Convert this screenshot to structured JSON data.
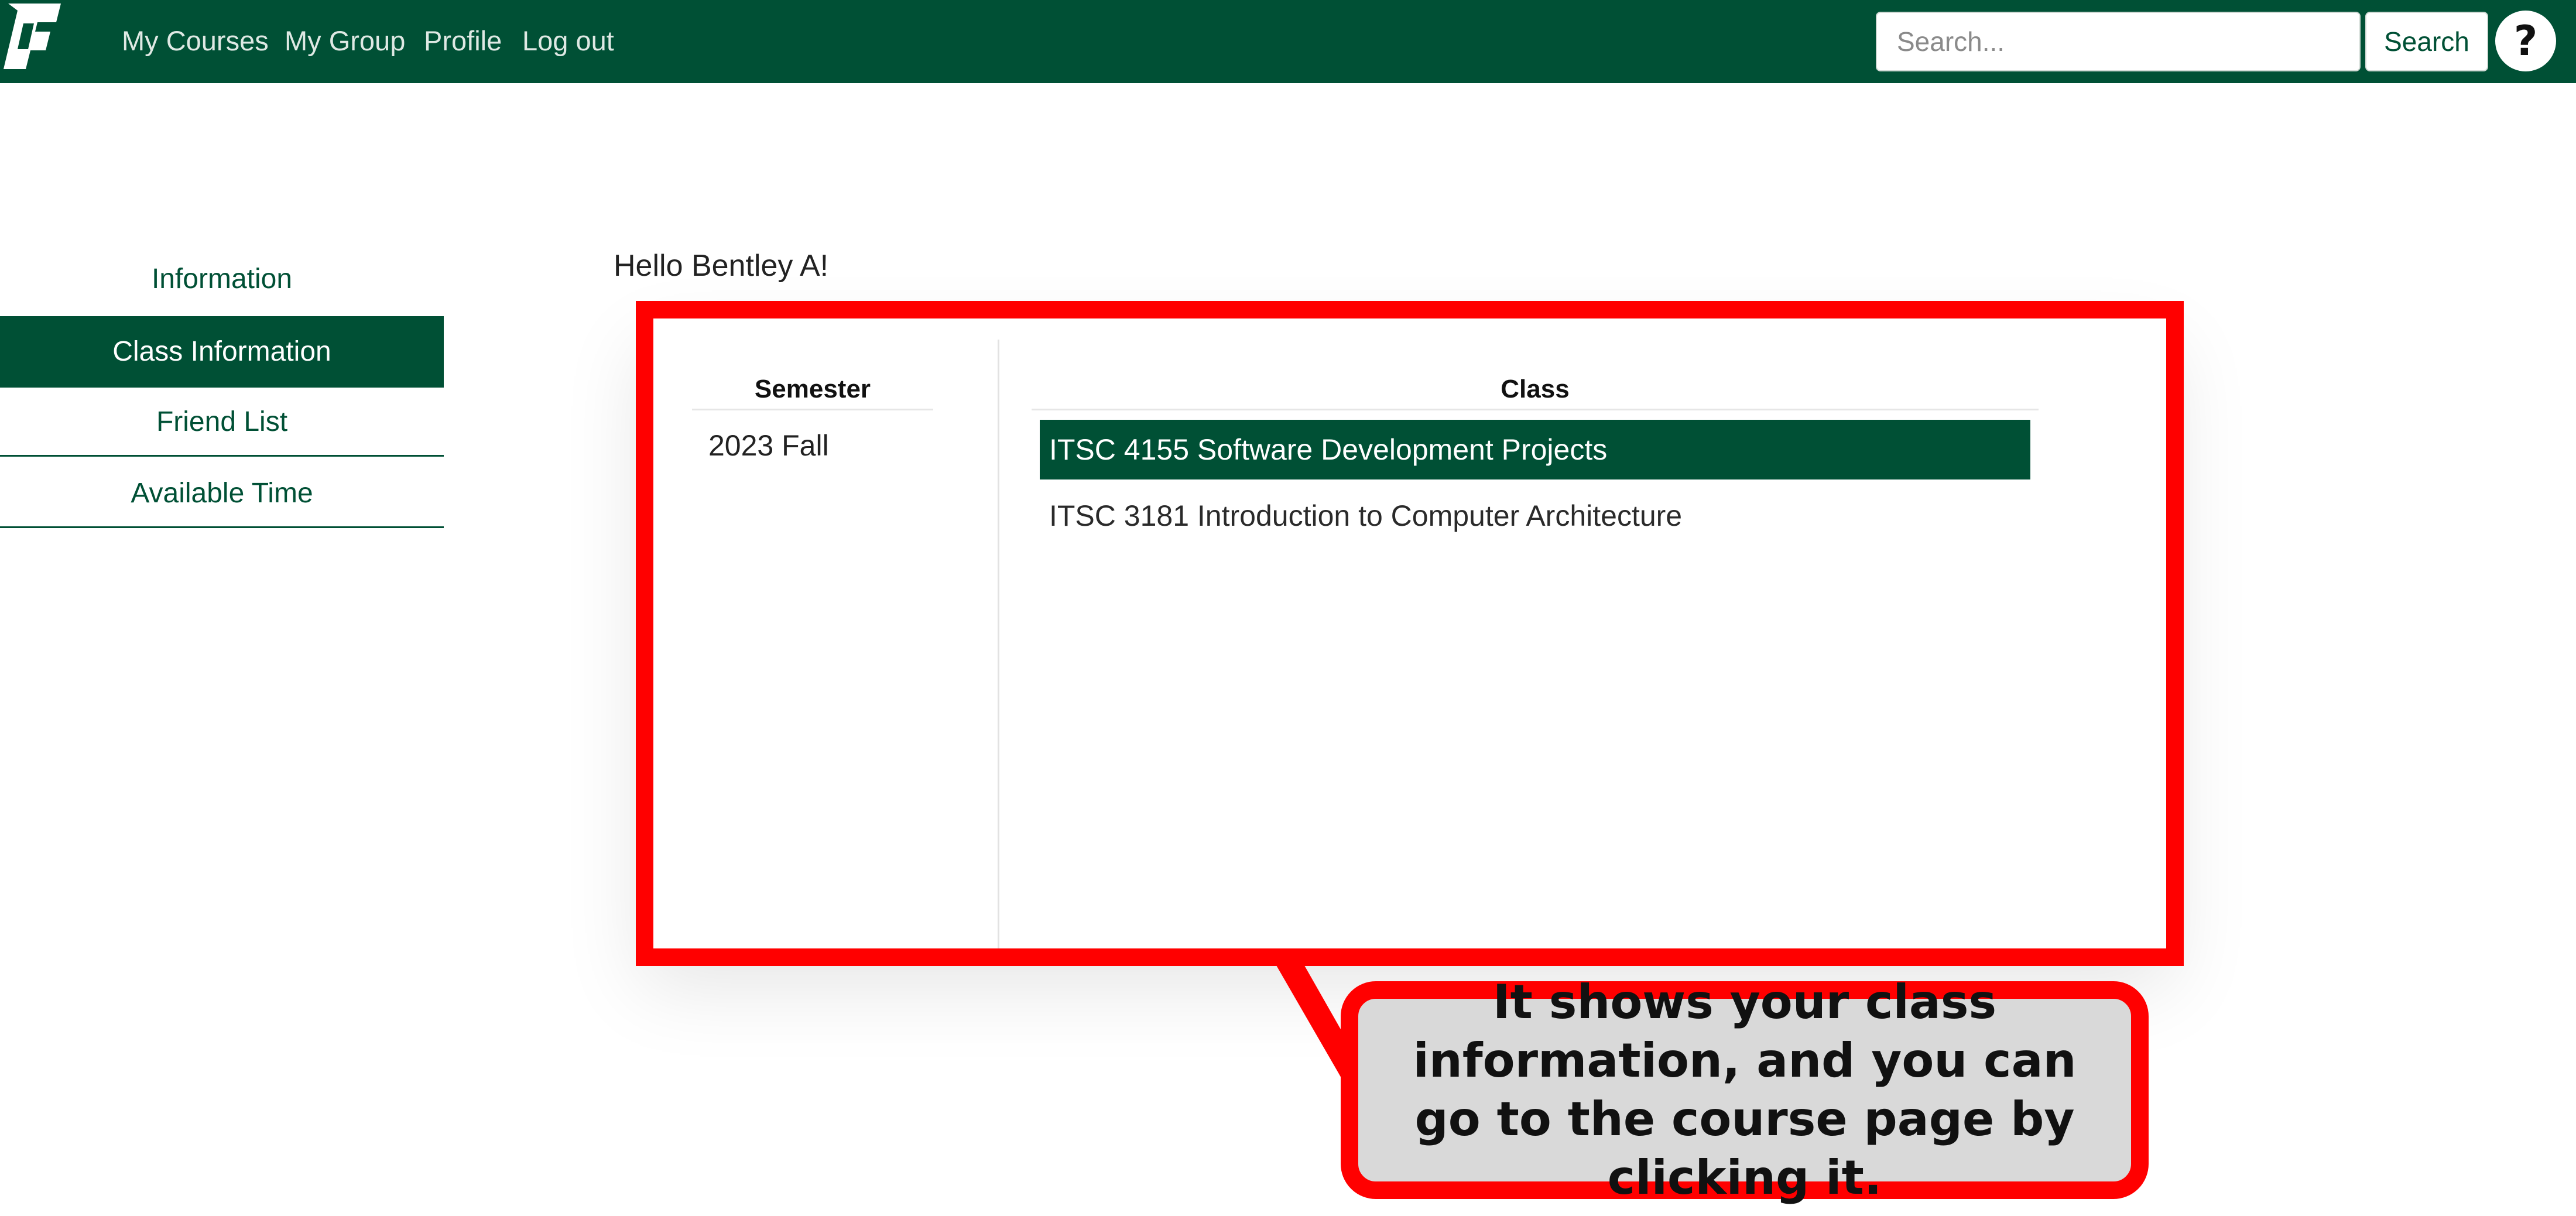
{
  "topbar": {
    "logo": "unc-charlotte-logo",
    "nav": [
      "My Courses",
      "My Group",
      "Profile",
      "Log out"
    ],
    "search_placeholder": "Search...",
    "search_button": "Search",
    "help_icon": "?"
  },
  "sidebar": {
    "items": [
      {
        "label": "Information"
      },
      {
        "label": "Class Information"
      },
      {
        "label": "Friend List"
      },
      {
        "label": "Available Time"
      }
    ]
  },
  "main": {
    "greeting": "Hello Bentley A!",
    "semester_header": "Semester",
    "class_header": "Class",
    "semesters": [
      "2023 Fall"
    ],
    "classes": [
      "ITSC 4155 Software Development Projects",
      "ITSC 3181 Introduction to Computer Architecture"
    ]
  },
  "annotation": {
    "callout": "It shows your class information, and you can go to the course page by clicking it."
  },
  "colors": {
    "brand_green": "#005035",
    "annotation_red": "#ff0000"
  }
}
